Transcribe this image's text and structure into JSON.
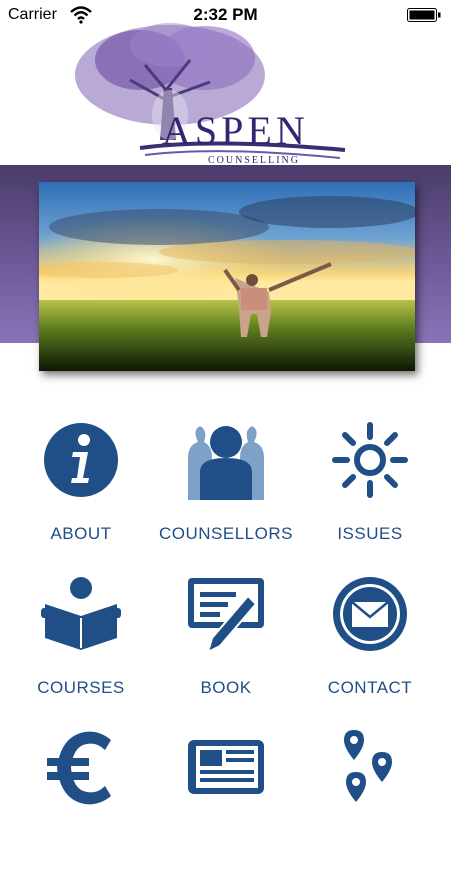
{
  "status_bar": {
    "carrier": "Carrier",
    "time": "2:32 PM"
  },
  "brand": {
    "name": "ASPEN",
    "tagline": "COUNSELLING"
  },
  "colors": {
    "icon_blue": "#1f4f86",
    "band_purple": "#6e5a98"
  },
  "menu": [
    {
      "label": "ABOUT",
      "icon": "info-icon"
    },
    {
      "label": "COUNSELLORS",
      "icon": "people-icon"
    },
    {
      "label": "ISSUES",
      "icon": "sun-icon"
    },
    {
      "label": "COURSES",
      "icon": "reader-icon"
    },
    {
      "label": "BOOK",
      "icon": "booking-icon"
    },
    {
      "label": "CONTACT",
      "icon": "mail-icon"
    },
    {
      "label": "",
      "icon": "euro-icon"
    },
    {
      "label": "",
      "icon": "newspaper-icon"
    },
    {
      "label": "",
      "icon": "map-pins-icon"
    }
  ]
}
